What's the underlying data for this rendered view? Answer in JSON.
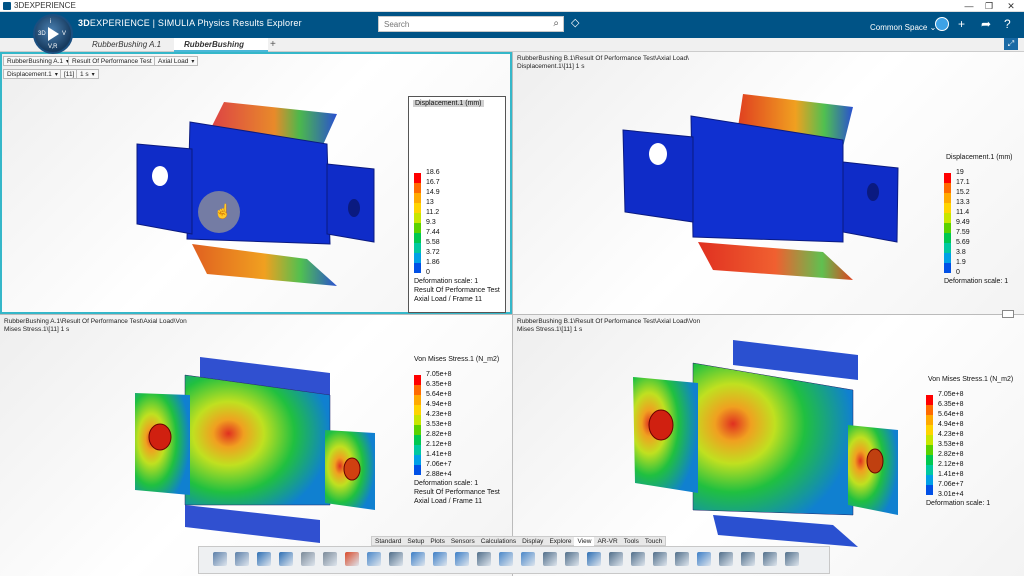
{
  "window": {
    "title": "3DEXPERIENCE",
    "controls": [
      "—",
      "❐",
      "✕"
    ]
  },
  "app": {
    "brand_bold": "3D",
    "brand_rest": "EXPERIENCE | SIMULIA Physics Results Explorer",
    "compass": {
      "left": "3D",
      "right": "V",
      "top": "i",
      "bottom": "V,R"
    },
    "search_placeholder": "Search",
    "space_label": "Common Space",
    "accent": "#005386"
  },
  "tabs": [
    {
      "label": "RubberBushing A.1",
      "active": false
    },
    {
      "label": "RubberBushing B.1",
      "active": true
    }
  ],
  "viewport1": {
    "dropdowns": [
      "RubberBushing A.1",
      "Result Of Performance Test",
      "Axial Load",
      "Displacement.1",
      "[11]",
      "1 s"
    ],
    "legend": {
      "title": "Displacement.1 (mm)",
      "ticks": [
        "18.6",
        "16.7",
        "14.9",
        "13",
        "11.2",
        "9.3",
        "7.44",
        "5.58",
        "3.72",
        "1.86",
        "0"
      ],
      "footer": [
        "Deformation scale: 1",
        "Result Of Performance Test",
        "Axial Load / Frame 11"
      ]
    }
  },
  "viewport2": {
    "header": [
      "RubberBushing B.1\\Result Of Performance Test\\Axial Load\\",
      "Displacement.1\\[11]    1 s"
    ],
    "legend": {
      "title": "Displacement.1 (mm)",
      "ticks": [
        "19",
        "17.1",
        "15.2",
        "13.3",
        "11.4",
        "9.49",
        "7.59",
        "5.69",
        "3.8",
        "1.9",
        "0"
      ],
      "footer": [
        "Deformation scale: 1"
      ]
    }
  },
  "viewport3": {
    "header": [
      "RubberBushing A.1\\Result Of Performance Test\\Axial Load\\Von",
      "Mises Stress.1\\[11]    1 s"
    ],
    "legend": {
      "title": "Von Mises Stress.1 (N_m2)",
      "ticks": [
        "7.05e+8",
        "6.35e+8",
        "5.64e+8",
        "4.94e+8",
        "4.23e+8",
        "3.53e+8",
        "2.82e+8",
        "2.12e+8",
        "1.41e+8",
        "7.06e+7",
        "2.88e+4"
      ],
      "footer": [
        "Deformation scale: 1",
        "Result Of Performance Test",
        "Axial Load / Frame 11"
      ]
    }
  },
  "viewport4": {
    "header": [
      "RubberBushing B.1\\Result Of Performance Test\\Axial Load\\Von",
      "Mises Stress.1\\[11]    1 s"
    ],
    "legend": {
      "title": "Von Mises Stress.1 (N_m2)",
      "ticks": [
        "7.05e+8",
        "6.35e+8",
        "5.64e+8",
        "4.94e+8",
        "4.23e+8",
        "3.53e+8",
        "2.82e+8",
        "2.12e+8",
        "1.41e+8",
        "7.06e+7",
        "3.01e+4"
      ],
      "footer": [
        "Deformation scale: 1"
      ]
    }
  },
  "action_bar_tabs": [
    "Standard",
    "Setup",
    "Plots",
    "Sensors",
    "Calculations",
    "Display",
    "Explore",
    "View",
    "AR-VR",
    "Tools",
    "Touch"
  ],
  "action_bar_active": "View",
  "colors": {
    "legend_scale": [
      "#ff0000",
      "#ff6a00",
      "#ffaa00",
      "#ffd400",
      "#c8e600",
      "#5ad200",
      "#00c850",
      "#00c8a0",
      "#00a0e6",
      "#0050e6",
      "#0000c8"
    ]
  }
}
